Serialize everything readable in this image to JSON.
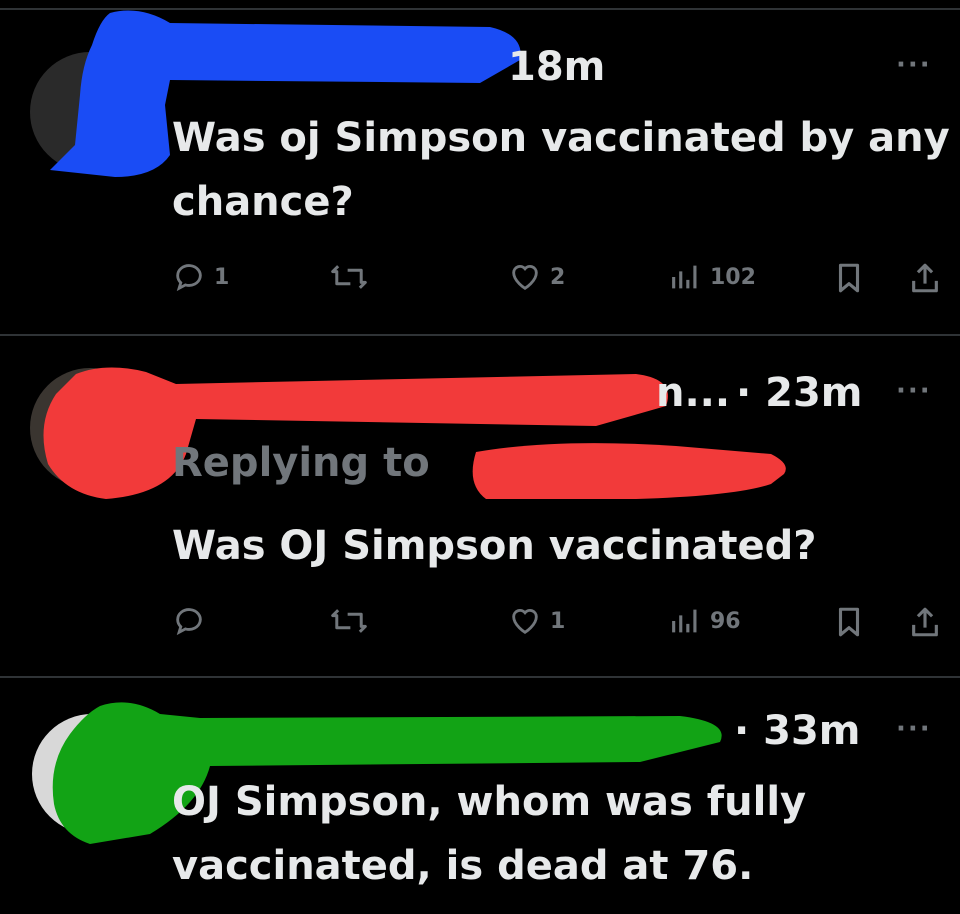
{
  "colors": {
    "background": "#000000",
    "text": "#e7e9ea",
    "muted": "#71767b",
    "divider": "#2f3336",
    "redact_blue": "#1a4cf5",
    "redact_red": "#f23a3a",
    "redact_green": "#12a315"
  },
  "tweets": [
    {
      "time": "18m",
      "more": "···",
      "text": "Was oj Simpson vaccinated by any chance?",
      "replies": "1",
      "retweets": "",
      "likes": "2",
      "views": "102"
    },
    {
      "handle_fragment": "n...",
      "time": "· 23m",
      "more": "···",
      "replying_to": "Replying to",
      "text": "Was OJ Simpson vaccinated?",
      "replies": "",
      "retweets": "",
      "likes": "1",
      "views": "96"
    },
    {
      "time": "· 33m",
      "more": "···",
      "text": "OJ Simpson, whom was fully vaccinated, is dead at 76."
    }
  ],
  "icons": [
    "reply-icon",
    "retweet-icon",
    "like-icon",
    "views-icon",
    "bookmark-icon",
    "share-icon",
    "more-icon"
  ]
}
